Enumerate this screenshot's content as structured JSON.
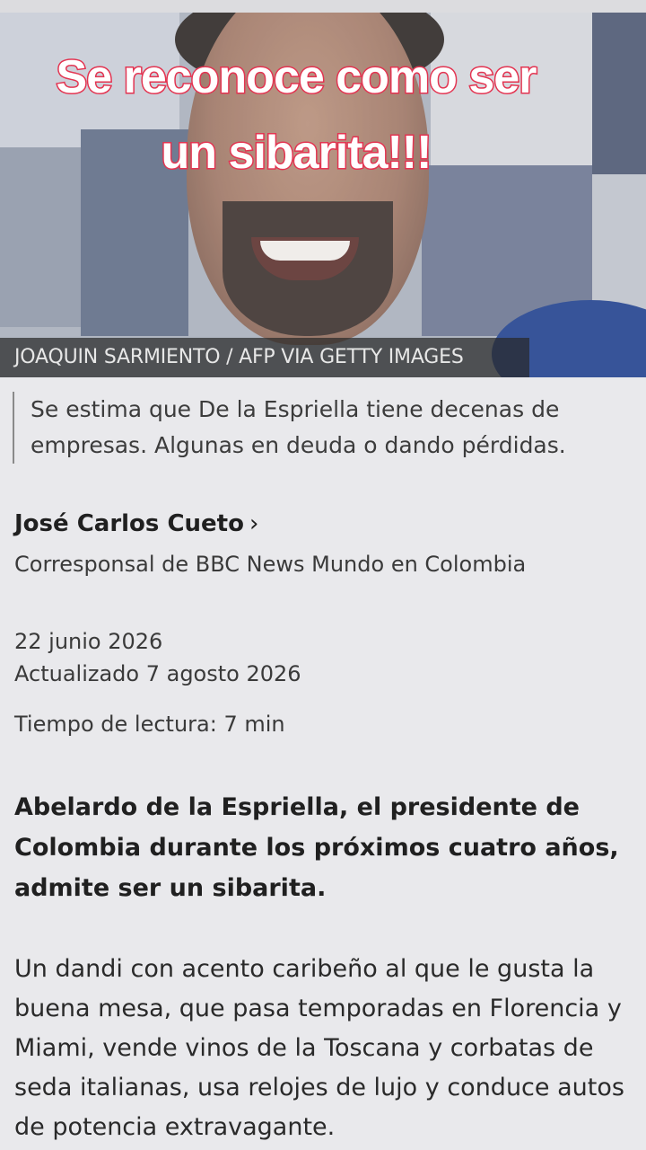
{
  "overlay": {
    "headline_line1": "Se reconoce como ser",
    "headline_line2": "un sibarita!!!",
    "text_color": "#ffffff",
    "stroke_color": "#e33451"
  },
  "photo": {
    "credit": "JOAQUIN SARMIENTO / AFP VIA GETTY IMAGES"
  },
  "article": {
    "caption": "Se estima que De la Espriella tiene decenas de empresas. Algunas en deuda o dando pérdidas.",
    "author_name": "José Carlos Cueto",
    "author_chevron": "›",
    "author_role": "Corresponsal de BBC News Mundo en Colombia",
    "published": "22 junio 2026",
    "updated": "Actualizado 7 agosto 2026",
    "reading_time": "Tiempo de lectura: 7 min",
    "lead": "Abelardo de la Espriella, el presidente de Colombia durante los próximos cuatro años, admite ser un sibarita.",
    "paragraph1": "Un dandi con acento caribeño al que le gusta la buena mesa, que pasa temporadas en Florencia y Miami, vende vinos de la Toscana y corbatas de seda italianas, usa relojes de lujo y conduce autos de potencia extravagante."
  }
}
